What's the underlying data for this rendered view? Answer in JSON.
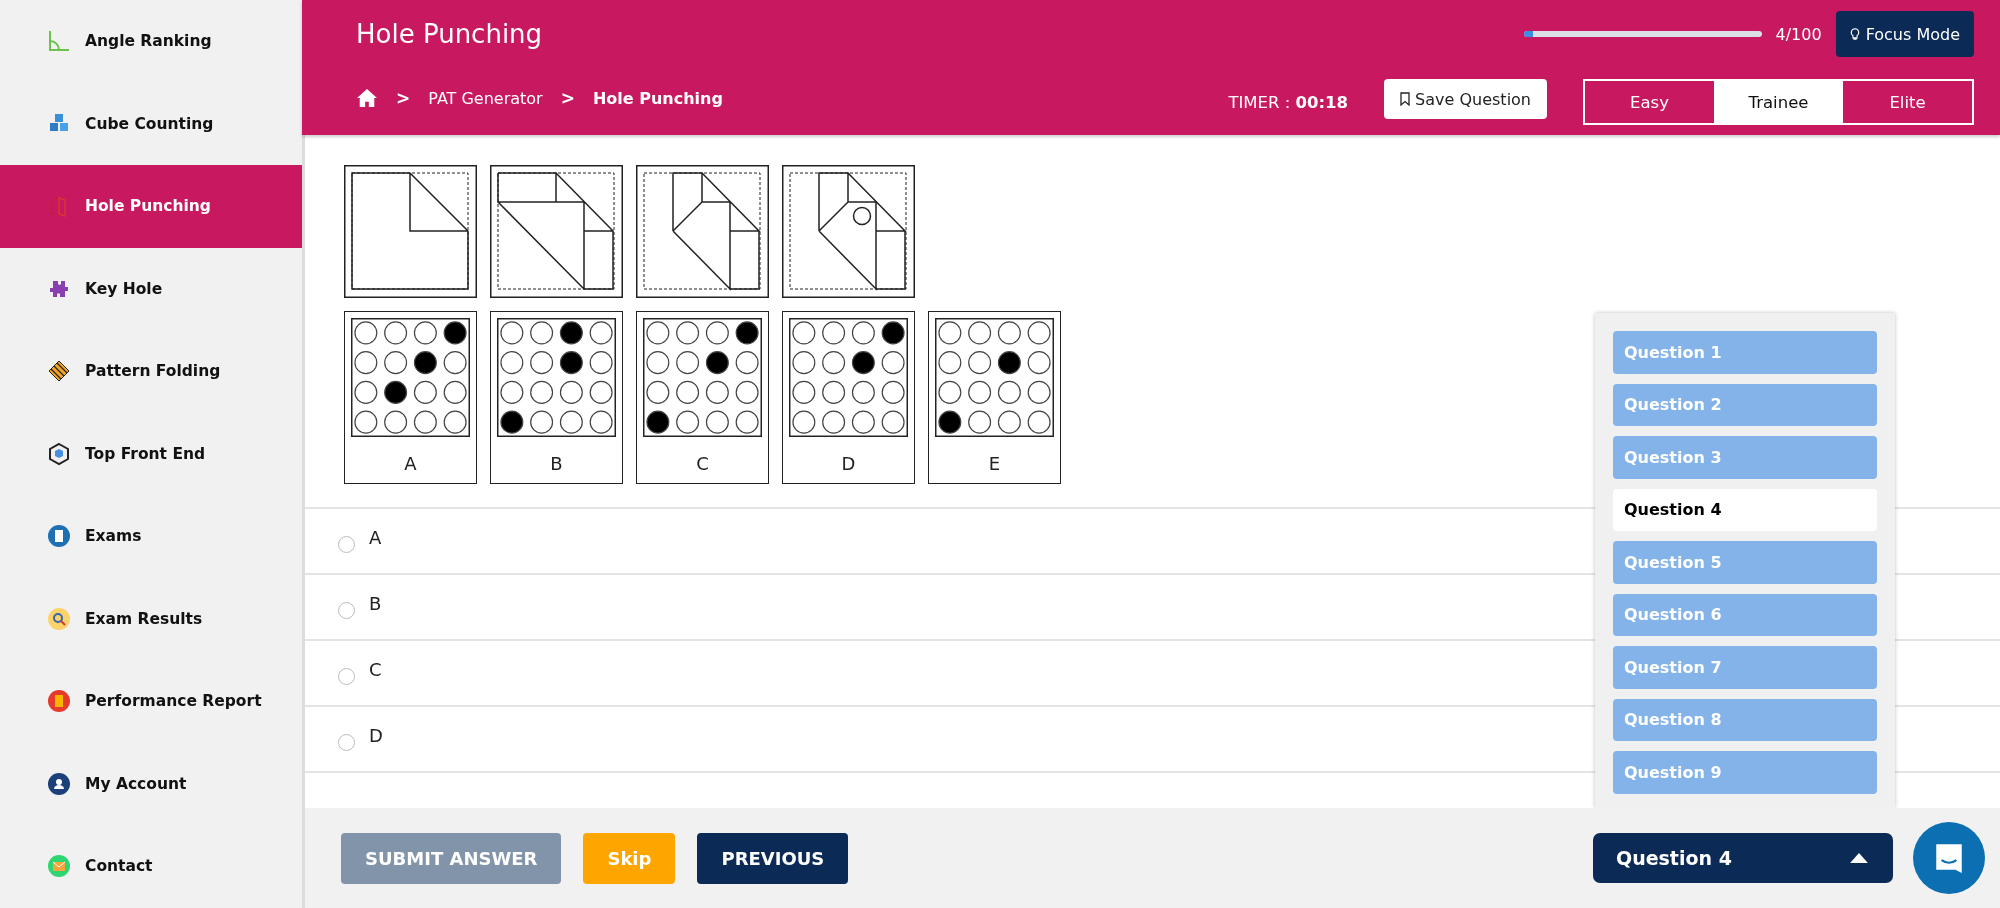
{
  "sidebar": {
    "items": [
      {
        "label": "Angle Ranking",
        "selected": false
      },
      {
        "label": "Cube Counting",
        "selected": false
      },
      {
        "label": "Hole Punching",
        "selected": true
      },
      {
        "label": "Key Hole",
        "selected": false
      },
      {
        "label": "Pattern Folding",
        "selected": false
      },
      {
        "label": "Top Front End",
        "selected": false
      },
      {
        "label": "Exams",
        "selected": false
      },
      {
        "label": "Exam Results",
        "selected": false
      },
      {
        "label": "Performance Report",
        "selected": false
      },
      {
        "label": "My Account",
        "selected": false
      },
      {
        "label": "Contact",
        "selected": false
      }
    ]
  },
  "header": {
    "title": "Hole Punching",
    "progress": {
      "level": 0.04,
      "reading": "4/100"
    },
    "focus_button": "Focus Mode",
    "breadcrumb": [
      {
        "kind": "home"
      },
      {
        "kind": "separator",
        "text": ">"
      },
      {
        "kind": "link",
        "text": "PAT Generator"
      },
      {
        "kind": "separator",
        "text": ">"
      },
      {
        "kind": "current",
        "text": "Hole Punching"
      }
    ],
    "timer": {
      "label": "TIMER :",
      "value": "00:18"
    },
    "save_button": "Save Question",
    "difficulty": [
      {
        "label": "Easy",
        "selected": false
      },
      {
        "label": "Trainee",
        "selected": true
      },
      {
        "label": "Elite",
        "selected": false
      }
    ]
  },
  "question": {
    "answer_figures": [
      {
        "label": "A",
        "rows": [
          {
            "holes": [
              {
                "filled": false
              },
              {
                "filled": false
              },
              {
                "filled": false
              },
              {
                "filled": true
              }
            ]
          },
          {
            "holes": [
              {
                "filled": false
              },
              {
                "filled": false
              },
              {
                "filled": true
              },
              {
                "filled": false
              }
            ]
          },
          {
            "holes": [
              {
                "filled": false
              },
              {
                "filled": true
              },
              {
                "filled": false
              },
              {
                "filled": false
              }
            ]
          },
          {
            "holes": [
              {
                "filled": false
              },
              {
                "filled": false
              },
              {
                "filled": false
              },
              {
                "filled": false
              }
            ]
          }
        ]
      },
      {
        "label": "B",
        "rows": [
          {
            "holes": [
              {
                "filled": false
              },
              {
                "filled": false
              },
              {
                "filled": true
              },
              {
                "filled": false
              }
            ]
          },
          {
            "holes": [
              {
                "filled": false
              },
              {
                "filled": false
              },
              {
                "filled": true
              },
              {
                "filled": false
              }
            ]
          },
          {
            "holes": [
              {
                "filled": false
              },
              {
                "filled": false
              },
              {
                "filled": false
              },
              {
                "filled": false
              }
            ]
          },
          {
            "holes": [
              {
                "filled": true
              },
              {
                "filled": false
              },
              {
                "filled": false
              },
              {
                "filled": false
              }
            ]
          }
        ]
      },
      {
        "label": "C",
        "rows": [
          {
            "holes": [
              {
                "filled": false
              },
              {
                "filled": false
              },
              {
                "filled": false
              },
              {
                "filled": true
              }
            ]
          },
          {
            "holes": [
              {
                "filled": false
              },
              {
                "filled": false
              },
              {
                "filled": true
              },
              {
                "filled": false
              }
            ]
          },
          {
            "holes": [
              {
                "filled": false
              },
              {
                "filled": false
              },
              {
                "filled": false
              },
              {
                "filled": false
              }
            ]
          },
          {
            "holes": [
              {
                "filled": true
              },
              {
                "filled": false
              },
              {
                "filled": false
              },
              {
                "filled": false
              }
            ]
          }
        ]
      },
      {
        "label": "D",
        "rows": [
          {
            "holes": [
              {
                "filled": false
              },
              {
                "filled": false
              },
              {
                "filled": false
              },
              {
                "filled": true
              }
            ]
          },
          {
            "holes": [
              {
                "filled": false
              },
              {
                "filled": false
              },
              {
                "filled": true
              },
              {
                "filled": false
              }
            ]
          },
          {
            "holes": [
              {
                "filled": false
              },
              {
                "filled": false
              },
              {
                "filled": false
              },
              {
                "filled": false
              }
            ]
          },
          {
            "holes": [
              {
                "filled": false
              },
              {
                "filled": false
              },
              {
                "filled": false
              },
              {
                "filled": false
              }
            ]
          }
        ]
      },
      {
        "label": "E",
        "rows": [
          {
            "holes": [
              {
                "filled": false
              },
              {
                "filled": false
              },
              {
                "filled": false
              },
              {
                "filled": false
              }
            ]
          },
          {
            "holes": [
              {
                "filled": false
              },
              {
                "filled": false
              },
              {
                "filled": true
              },
              {
                "filled": false
              }
            ]
          },
          {
            "holes": [
              {
                "filled": false
              },
              {
                "filled": false
              },
              {
                "filled": false
              },
              {
                "filled": false
              }
            ]
          },
          {
            "holes": [
              {
                "filled": true
              },
              {
                "filled": false
              },
              {
                "filled": false
              },
              {
                "filled": false
              }
            ]
          }
        ]
      }
    ],
    "options": [
      {
        "label": "A",
        "selected": false
      },
      {
        "label": "B",
        "selected": false
      },
      {
        "label": "C",
        "selected": false
      },
      {
        "label": "D",
        "selected": false
      }
    ]
  },
  "footer": {
    "buttons": [
      {
        "label": "SUBMIT ANSWER",
        "kind": "submit"
      },
      {
        "label": "Skip",
        "kind": "skip"
      },
      {
        "label": "PREVIOUS",
        "kind": "previous"
      }
    ]
  },
  "question_picker": {
    "label": "Question 4",
    "expanded": true,
    "items": [
      {
        "label": "Question 1",
        "selected": false
      },
      {
        "label": "Question 2",
        "selected": false
      },
      {
        "label": "Question 3",
        "selected": false
      },
      {
        "label": "Question 4",
        "selected": true
      },
      {
        "label": "Question 5",
        "selected": false
      },
      {
        "label": "Question 6",
        "selected": false
      },
      {
        "label": "Question 7",
        "selected": false
      },
      {
        "label": "Question 8",
        "selected": false
      },
      {
        "label": "Question 9",
        "selected": false
      }
    ]
  }
}
